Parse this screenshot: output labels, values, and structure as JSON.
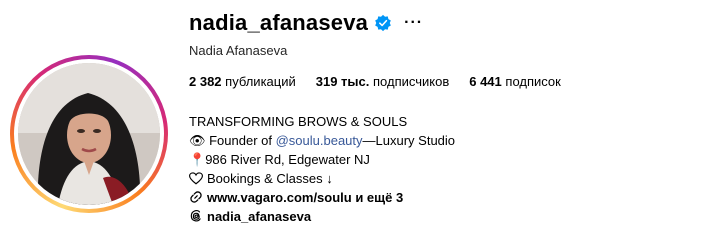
{
  "profile": {
    "username": "nadia_afanaseva",
    "full_name": "Nadia Afanaseva",
    "verified": true,
    "more_icon": "ellipsis-icon"
  },
  "stats": {
    "posts_value": "2 382",
    "posts_label": "публикаций",
    "followers_value": "319 тыс.",
    "followers_label": "подписчиков",
    "following_value": "6 441",
    "following_label": "подписок"
  },
  "bio": {
    "headline": "TRANSFORMING BROWS & SOULS",
    "founder_prefix": "👁 Founder of ",
    "founder_mention": "@soulu.beauty",
    "founder_suffix": "—Luxury Studio",
    "address": "986 River Rd, Edgewater NJ",
    "bookings": "Bookings & Classes ↓",
    "website": "www.vagaro.com/soulu и ещё 3",
    "threads_handle": "nadia_afanaseva"
  },
  "colors": {
    "link": "#385898",
    "verified_badge": "#0095f6"
  }
}
